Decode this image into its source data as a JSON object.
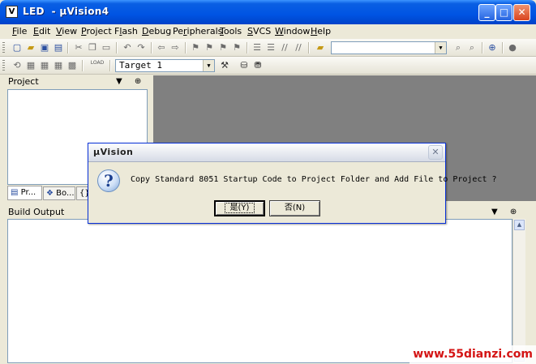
{
  "window": {
    "title": "LED  - µVision4",
    "app_icon_glyph": "V",
    "controls": {
      "minimize": "_",
      "maximize": "□",
      "close": "✕"
    }
  },
  "menubar": {
    "items": [
      {
        "u": "F",
        "rest": "ile"
      },
      {
        "u": "E",
        "rest": "dit"
      },
      {
        "u": "V",
        "rest": "iew"
      },
      {
        "u": "P",
        "rest": "roject"
      },
      {
        "pre": "F",
        "u": "l",
        "rest": "ash"
      },
      {
        "u": "D",
        "rest": "ebug"
      },
      {
        "pre": "Pe",
        "u": "r",
        "rest": "ipherals"
      },
      {
        "u": "T",
        "rest": "ools"
      },
      {
        "u": "S",
        "rest": "VCS"
      },
      {
        "u": "W",
        "rest": "indow"
      },
      {
        "u": "H",
        "rest": "elp"
      }
    ]
  },
  "toolbar2": {
    "target_select": "Target 1",
    "load_label": "LOAD"
  },
  "project_pane": {
    "title": "Project",
    "header_buttons": "▼ ⊕ ✕",
    "tabs": [
      "Pr...",
      "Bo...",
      "{}"
    ]
  },
  "build_output": {
    "title": "Build Output",
    "header_buttons": "▼ ⊕ ✕"
  },
  "dialog": {
    "title": "µVision",
    "message": "Copy Standard 8051 Startup Code to Project Folder and Add File to Project ?",
    "icon_glyph": "?",
    "close_glyph": "✕",
    "yes_button": "是(Y)",
    "no_button": "否(N)"
  },
  "watermark": "www.55dianzi.com",
  "colors": {
    "titlebar": "#0054e3",
    "editor_bg": "#808080",
    "watermark_text": "#d41414"
  }
}
